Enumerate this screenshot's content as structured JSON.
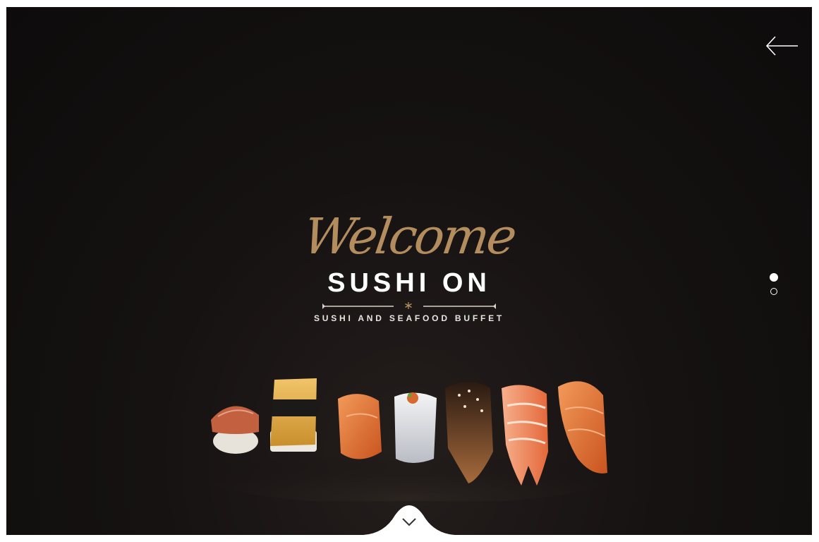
{
  "hero": {
    "welcome": "Welcome",
    "brand": "SUSHI ON",
    "tagline": "SUSHI AND SEAFOOD BUFFET"
  },
  "slider": {
    "slide_count": 2,
    "active_index": 0
  },
  "icons": {
    "back": "arrow-left-icon",
    "scroll": "chevron-down-icon",
    "ornament": "asterisk-icon"
  },
  "colors": {
    "background": "#151111",
    "accent_gold": "#b48d5e",
    "text_light": "#ffffff"
  }
}
